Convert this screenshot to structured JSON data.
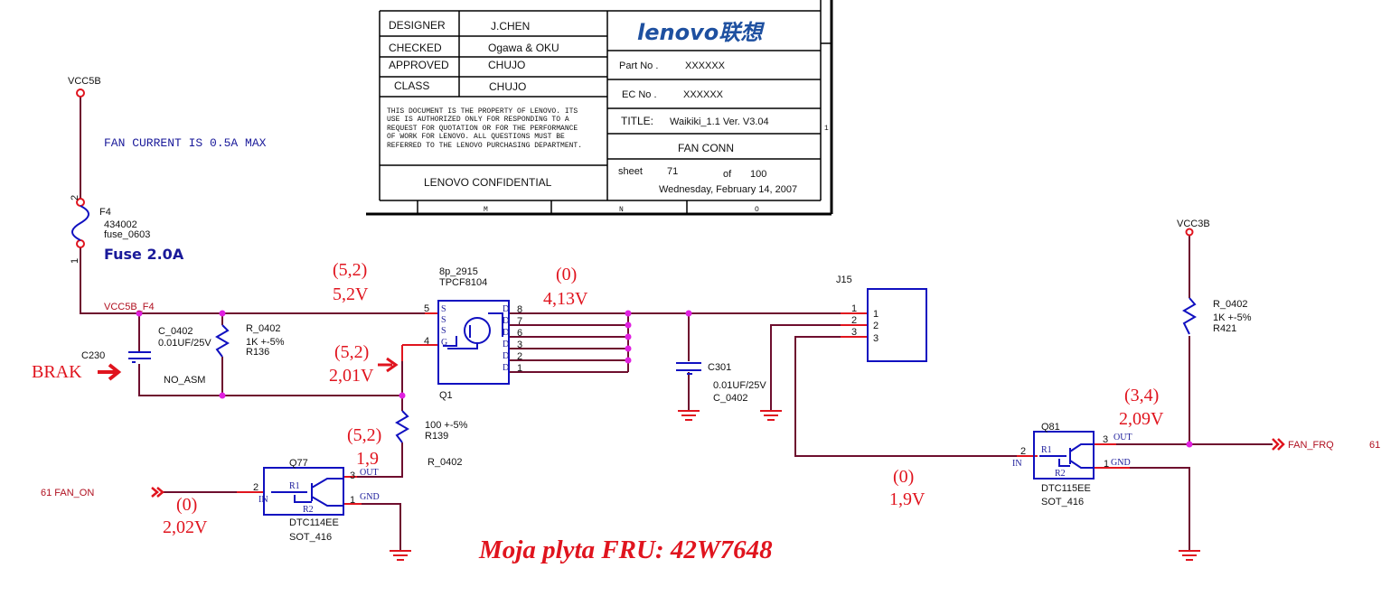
{
  "title_block": {
    "designer_label": "DESIGNER",
    "designer": "J.CHEN",
    "checked_label": "CHECKED",
    "checked": "Ogawa & OKU",
    "approved_label": "APPROVED",
    "approved": "CHUJO",
    "class_label": "CLASS",
    "class": "CHUJO",
    "notice": [
      "THIS DOCUMENT IS THE PROPERTY OF LENOVO. ITS",
      "USE IS AUTHORIZED ONLY FOR RESPONDING TO A",
      "REQUEST FOR QUOTATION OR FOR THE PERFORMANCE",
      "OF WORK FOR LENOVO. ALL QUESTIONS MUST BE",
      "REFERRED TO THE LENOVO PURCHASING DEPARTMENT."
    ],
    "confidential": "LENOVO CONFIDENTIAL",
    "logo": "lenovo联想",
    "part_no_label": "Part No .",
    "part_no": "XXXXXX",
    "ec_no_label": "EC No .",
    "ec_no": "XXXXXX",
    "title_label": "TITLE:",
    "title": "Waikiki_1.1   Ver. V3.04",
    "sheet_name": "FAN CONN",
    "sheet_label": "sheet",
    "sheet": "71",
    "of_label": "of",
    "sheet_total": "100",
    "date": "Wednesday, February 14, 2007",
    "zones": [
      "M",
      "N",
      "O"
    ],
    "row_marker": "1"
  },
  "notes": {
    "fan_current": "FAN CURRENT  IS 0.5A MAX",
    "board": "Moja plyta FRU: 42W7648",
    "brak": "BRAK"
  },
  "nets": {
    "vcc5b": "VCC5B",
    "vcc5b_f4": "VCC5B_F4",
    "vcc3b": "VCC3B",
    "fan_on": "61  FAN_ON",
    "fan_frq": "FAN_FRQ",
    "fan_frq_page": "61"
  },
  "components": {
    "f4": {
      "ref": "F4",
      "part": "434002",
      "pkg": "fuse_0603",
      "rating": "Fuse  2.0A",
      "pin_top": "2",
      "pin_bottom": "1"
    },
    "c230": {
      "ref": "C230",
      "pkg": "C_0402",
      "value": "0.01UF/25V",
      "note": "NO_ASM"
    },
    "r136": {
      "ref": "R136",
      "pkg": "R_0402",
      "value": "1K +-5%"
    },
    "q1": {
      "ref": "Q1",
      "pkg": "8p_2915",
      "part": "TPCF8104",
      "left_pins": [
        "S",
        "S",
        "S",
        "G"
      ],
      "right_pins": [
        "D",
        "D",
        "D",
        "D",
        "D",
        "D"
      ],
      "pin_nums_right": [
        "8",
        "7",
        "6",
        "3",
        "2",
        "1"
      ],
      "pin_s": "5",
      "pin_g": "4"
    },
    "c301": {
      "ref": "C301",
      "value": "0.01UF/25V",
      "pkg": "C_0402"
    },
    "j15": {
      "ref": "J15",
      "pins": [
        "1",
        "2",
        "3"
      ]
    },
    "r139": {
      "ref": "R139",
      "value": "100 +-5%",
      "pkg": "R_0402"
    },
    "q77": {
      "ref": "Q77",
      "part": "DTC114EE",
      "pkg": "SOT_416",
      "in": "IN",
      "out": "OUT",
      "gnd": "GND",
      "r1": "R1",
      "r2": "R2",
      "pin_in": "2",
      "pin_out": "3",
      "pin_gnd": "1"
    },
    "r421": {
      "ref": "R421",
      "value": "1K +-5%",
      "pkg": "R_0402"
    },
    "q81": {
      "ref": "Q81",
      "part": "DTC115EE",
      "pkg": "SOT_416",
      "in": "IN",
      "out": "OUT",
      "gnd": "GND",
      "r1": "R1",
      "r2": "R2",
      "pin_in": "2",
      "pin_out": "3",
      "pin_gnd": "1"
    }
  },
  "measurements": {
    "source": {
      "code": "(5,2)",
      "volts": "5,2V"
    },
    "gate": {
      "code": "(5,2)",
      "volts": "2,01V"
    },
    "drain": {
      "code": "(0)",
      "volts": "4,13V"
    },
    "q77_out": {
      "code": "(5,2)",
      "volts": "1,9"
    },
    "fan_on": {
      "code": "(0)",
      "volts": "2,02V"
    },
    "j15_pin3": {
      "code": "(0)",
      "volts": "1,9V"
    },
    "fan_frq": {
      "code": "(3,4)",
      "volts": "2,09V"
    }
  },
  "colors": {
    "wire": "#6e0e2e",
    "symbol": "#1010c0",
    "annotation": "#e0141e",
    "junction": "#e020e0"
  }
}
